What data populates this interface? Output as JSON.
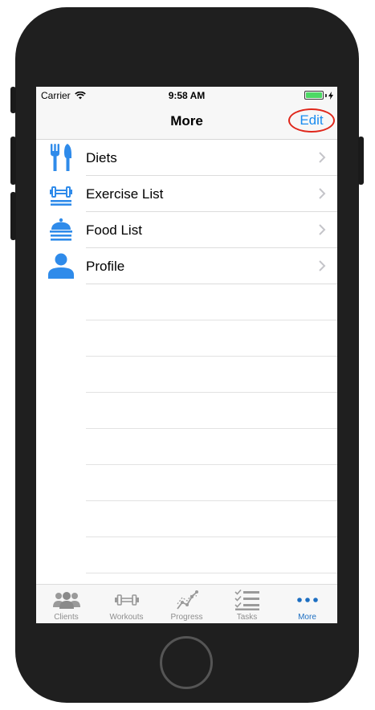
{
  "status_bar": {
    "carrier": "Carrier",
    "time": "9:58 AM"
  },
  "nav": {
    "title": "More",
    "edit_label": "Edit"
  },
  "list": {
    "items": [
      {
        "label": "Diets",
        "icon": "fork-knife-icon"
      },
      {
        "label": "Exercise List",
        "icon": "dumbbell-icon"
      },
      {
        "label": "Food List",
        "icon": "food-tray-icon"
      },
      {
        "label": "Profile",
        "icon": "person-icon"
      }
    ]
  },
  "tabs": [
    {
      "label": "Clients",
      "icon": "group-icon"
    },
    {
      "label": "Workouts",
      "icon": "dumbbell-icon"
    },
    {
      "label": "Progress",
      "icon": "progress-chart-icon"
    },
    {
      "label": "Tasks",
      "icon": "checklist-icon"
    },
    {
      "label": "More",
      "icon": "more-dots-icon",
      "active": true
    }
  ],
  "colors": {
    "accent": "#1a8cf0",
    "icon_blue": "#2f8bea",
    "active_tab": "#1d6fc2",
    "inactive_tab": "#8e8e8e",
    "highlight_ring": "#e0271b",
    "battery": "#4cd964"
  }
}
